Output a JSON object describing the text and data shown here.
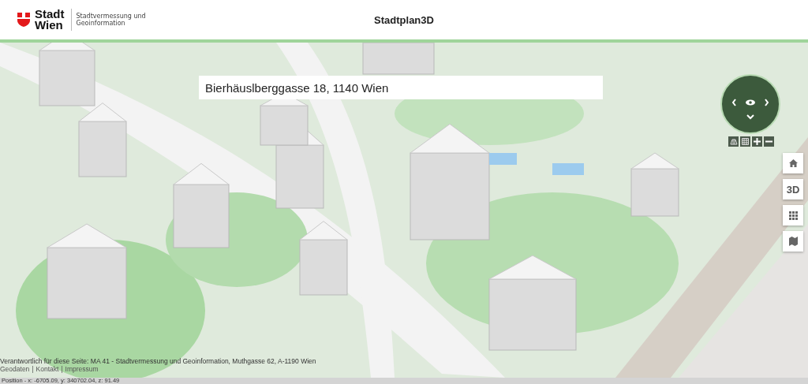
{
  "header": {
    "logo_lines": [
      "Stadt",
      "Wien"
    ],
    "department": "Stadtvermessung und Geoinformation",
    "title": "Stadtplan3D"
  },
  "search": {
    "value": "Bierhäuslberggasse 18, 1140 Wien"
  },
  "view_tools": [
    {
      "kind": "perspective"
    },
    {
      "kind": "grid"
    },
    {
      "kind": "zoom-in"
    },
    {
      "kind": "zoom-out"
    }
  ],
  "side_buttons": [
    {
      "kind": "home"
    },
    {
      "kind": "text",
      "label": "3D"
    },
    {
      "kind": "tiles"
    },
    {
      "kind": "map"
    }
  ],
  "footer": {
    "responsible": "Verantwortlich für diese Seite: MA 41 - Stadtvermessung und Geoinformation, Muthgasse 62, A-1190 Wien",
    "links": [
      "Geodaten",
      "Kontakt",
      "Impressum"
    ],
    "link_separator": "|",
    "position": "Position - x: -6705.09, y: 340702.04, z: 91.49"
  }
}
